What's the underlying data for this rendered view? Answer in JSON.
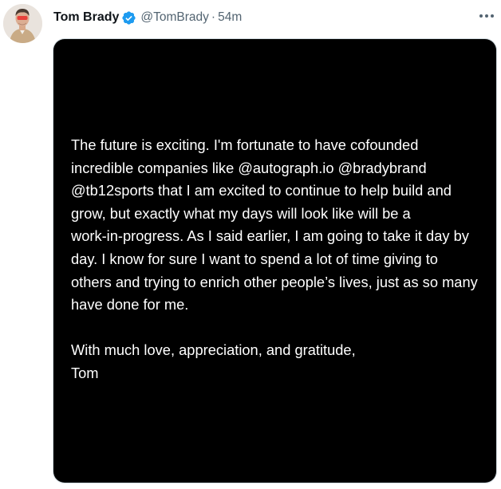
{
  "tweet": {
    "author": {
      "name": "Tom Brady",
      "handle": "@TomBrady",
      "verified": true,
      "avatar": "profile-photo"
    },
    "separator": "·",
    "timestamp": "54m",
    "more_icon": "more-horizontal-icon",
    "media_text": {
      "lines": [
        "The future is exciting.  I'm fortunate to have cofounded",
        "incredible companies like @autograph.io @bradybrand",
        "@tb12sports that I am excited to continue to help build and",
        "grow, but exactly what my days will look like will be a",
        "work-in-progress. As I said earlier, I am going to take it day by",
        "day.  I know for sure I want to spend a lot of time giving to",
        "others and trying to enrich other people’s lives, just as so many",
        "have done for me."
      ],
      "closing": [
        "With much love, appreciation, and gratitude,",
        "Tom"
      ]
    }
  },
  "colors": {
    "verified_badge": "#1d9bf0",
    "name": "#0f1419",
    "secondary_text": "#536471",
    "media_background": "#000000",
    "media_text": "#ffffff"
  }
}
